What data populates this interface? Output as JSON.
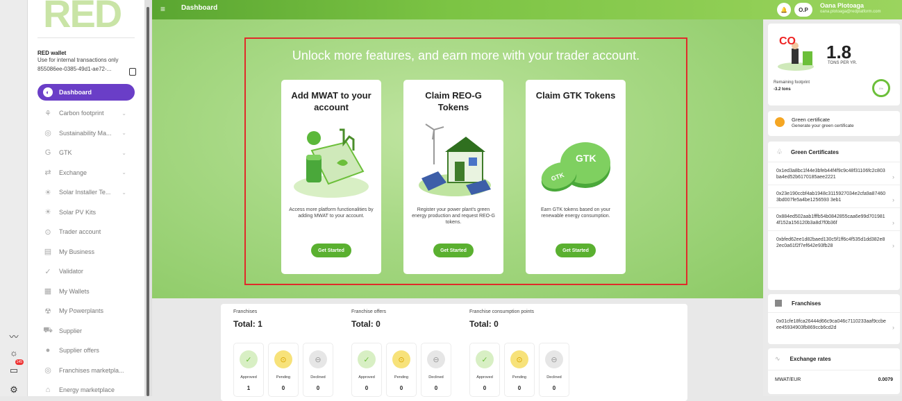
{
  "outer_rail": {
    "icons": [
      "chart-line-icon",
      "sun-icon",
      "chat-icon",
      "gear-icon"
    ],
    "badge": "145"
  },
  "sidebar": {
    "logo_text": "RED",
    "wallet": {
      "title": "RED wallet",
      "subtitle": "Use for internal transactions only",
      "address": "855086ee-0385-49d1-ae72-..."
    },
    "items": [
      {
        "label": "Dashboard",
        "icon": "dashboard-icon",
        "active": true
      },
      {
        "label": "Carbon footprint",
        "icon": "footprint-icon",
        "chevron": true
      },
      {
        "label": "Sustainability Ma...",
        "icon": "sustainability-icon",
        "chevron": true
      },
      {
        "label": "GTK",
        "icon": "gtk-icon",
        "chevron": true
      },
      {
        "label": "Exchange",
        "icon": "exchange-icon",
        "chevron": true
      },
      {
        "label": "Solar Installer Te...",
        "icon": "solar-installer-icon",
        "chevron": true
      },
      {
        "label": "Solar PV Kits",
        "icon": "solar-kit-icon"
      },
      {
        "label": "Trader account",
        "icon": "trader-icon"
      },
      {
        "label": "My Business",
        "icon": "business-icon"
      },
      {
        "label": "Validator",
        "icon": "validator-icon"
      },
      {
        "label": "My Wallets",
        "icon": "wallet-icon"
      },
      {
        "label": "My Powerplants",
        "icon": "powerplant-icon"
      },
      {
        "label": "Supplier",
        "icon": "supplier-icon"
      },
      {
        "label": "Supplier offers",
        "icon": "offers-icon"
      },
      {
        "label": "Franchises marketpla...",
        "icon": "franchise-market-icon"
      },
      {
        "label": "Energy marketplace",
        "icon": "energy-market-icon"
      }
    ]
  },
  "topbar": {
    "title": "Dashboard",
    "initials": "O.P",
    "user_name": "Oana Plotoaga",
    "user_email": "oana.plotoaga@redplatform.com"
  },
  "hero": {
    "headline": "Unlock more features, and earn more with your trader account.",
    "cards": [
      {
        "title": "Add MWAT to your account",
        "desc": "Access more platform functionalities by adding MWAT to your account.",
        "button": "Get Started"
      },
      {
        "title": "Claim REO-G Tokens",
        "desc": "Register your power plant's green energy production and request REO-G tokens.",
        "button": "Get Started"
      },
      {
        "title": "Claim GTK Tokens",
        "desc": "Earn GTK tokens based on your renewable energy consumption.",
        "button": "Get Started"
      }
    ]
  },
  "stats": [
    {
      "label": "Franchises",
      "total": "Total: 1",
      "boxes": [
        {
          "label": "Approved",
          "value": "1"
        },
        {
          "label": "Pending",
          "value": "0"
        },
        {
          "label": "Declined",
          "value": "0"
        }
      ]
    },
    {
      "label": "Franchise offers",
      "total": "Total: 0",
      "boxes": [
        {
          "label": "Approved",
          "value": "0"
        },
        {
          "label": "Pending",
          "value": "0"
        },
        {
          "label": "Declined",
          "value": "0"
        }
      ]
    },
    {
      "label": "Franchise consumption points",
      "total": "Total: 0",
      "boxes": [
        {
          "label": "Approved",
          "value": "0"
        },
        {
          "label": "Pending",
          "value": "0"
        },
        {
          "label": "Declined",
          "value": "0"
        }
      ]
    }
  ],
  "right": {
    "footprint": {
      "co2": "CO",
      "value": "1.8",
      "unit": "TONS PER YR.",
      "remaining_label": "Remaining footprint",
      "remaining_value": "-3.2 tons",
      "ring": "0%"
    },
    "green_cert": {
      "title": "Green certificate",
      "subtitle": "Generate your green certificate"
    },
    "green_certs_title": "Green Certificates",
    "hashes": [
      "0x1ed3a8bc1f44e3bfeb44f4f9c9c48f31106fc2c803ba4ed52b6170185aee2221",
      "0x23e190ccbf4ab1948c3115927034e2cfa9a874603bd007fe5a4be1256593 3eb1",
      "0x884ed502aab1fffb54b0842855caa6e99d7019814f152a156120b3a8d7f0b36f",
      "0xbfed62ee1d82baed130c5f1ff6c4f535d1dd382e82ec0a61f2f7ef642e93fb28"
    ],
    "franchises_title": "Franchises",
    "franchise_hash": "0x01cfe18fca26444d66c9ca046c7110233aaf9ccbeee45934903fb869ccb6cd2d",
    "exchange_title": "Exchange rates",
    "pair": "MWAT/EUR",
    "rate": "0.0079"
  }
}
